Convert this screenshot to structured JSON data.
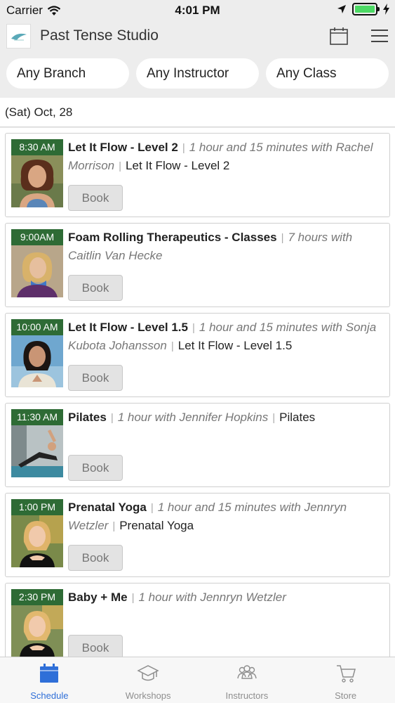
{
  "status_bar": {
    "carrier": "Carrier",
    "time": "4:01 PM"
  },
  "nav": {
    "title": "Past Tense Studio"
  },
  "filters": {
    "branch": "Any Branch",
    "instructor": "Any Instructor",
    "class": "Any Class"
  },
  "date_header": "(Sat) Oct, 28",
  "classes": [
    {
      "time": "8:30 AM",
      "name": "Let It Flow - Level 2",
      "meta": "1 hour and 15 minutes with Rachel Morrison",
      "category": "Let It Flow - Level 2",
      "book_label": "Book"
    },
    {
      "time": "9:00AM",
      "name": "Foam Rolling Therapeutics - Classes",
      "meta": "7 hours with Caitlin Van Hecke",
      "category": "",
      "book_label": "Book"
    },
    {
      "time": "10:00 AM",
      "name": "Let It Flow - Level 1.5",
      "meta": "1 hour and 15 minutes with Sonja Kubota Johansson",
      "category": "Let It Flow - Level 1.5",
      "book_label": "Book"
    },
    {
      "time": "11:30 AM",
      "name": "Pilates",
      "meta": "1 hour with Jennifer Hopkins",
      "category": "Pilates",
      "book_label": "Book"
    },
    {
      "time": "1:00 PM",
      "name": "Prenatal Yoga",
      "meta": "1 hour and 15 minutes with Jennryn Wetzler",
      "category": "Prenatal Yoga",
      "book_label": "Book"
    },
    {
      "time": "2:30 PM",
      "name": "Baby + Me",
      "meta": "1 hour with Jennryn Wetzler",
      "category": "",
      "book_label": "Book"
    }
  ],
  "tabs": [
    {
      "label": "Schedule",
      "icon": "calendar-icon",
      "active": true
    },
    {
      "label": "Workshops",
      "icon": "graduation-cap-icon",
      "active": false
    },
    {
      "label": "Instructors",
      "icon": "people-icon",
      "active": false
    },
    {
      "label": "Store",
      "icon": "cart-icon",
      "active": false
    }
  ],
  "colors": {
    "time_badge": "#2e6b35",
    "tab_active": "#2f6fd8",
    "battery": "#4cd964"
  }
}
